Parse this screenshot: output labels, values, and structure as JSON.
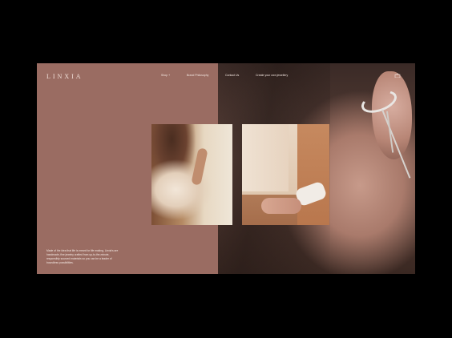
{
  "brand": {
    "logo_text": "LINXIA"
  },
  "nav": {
    "items": [
      {
        "label": "Shop +"
      },
      {
        "label": "Brand Philosophy"
      },
      {
        "label": "Contact Us"
      },
      {
        "label": "Create your own jewellery"
      }
    ],
    "cart_icon": "bag-icon"
  },
  "hero": {
    "tagline": "Made of the idea that life is meant for life making, Linxia's are handmade, fine jewelry crafted from up-to-the-minute, responsibly sourced materials so you can be a leader of boundless possibilities."
  },
  "colors": {
    "panel": "#9a6c62",
    "background": "#000000",
    "text_light": "#f4e7e1"
  }
}
